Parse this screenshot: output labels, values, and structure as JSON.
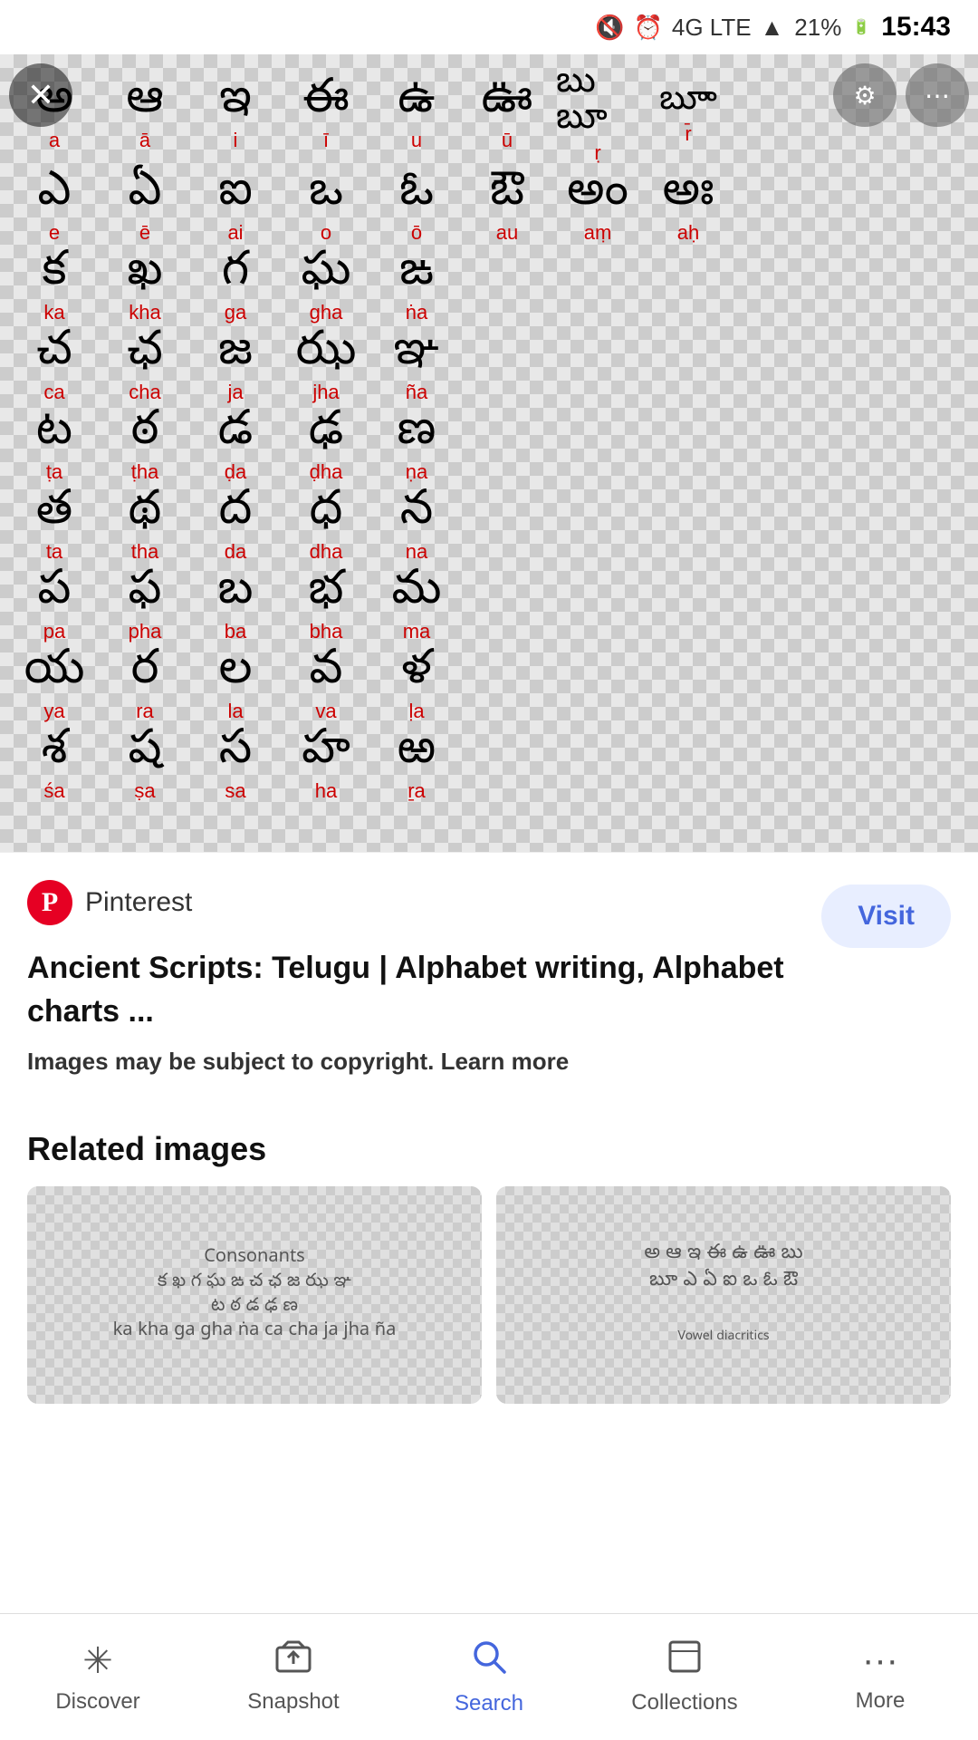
{
  "statusBar": {
    "time": "15:43",
    "battery": "21%",
    "network": "4G LTE",
    "signal": "●●●"
  },
  "image": {
    "altText": "Telugu alphabet chart",
    "rows": [
      [
        {
          "char": "అ",
          "label": "a"
        },
        {
          "char": "ఆ",
          "label": "ā"
        },
        {
          "char": "ఇ",
          "label": "i"
        },
        {
          "char": "ఈ",
          "label": "ī"
        },
        {
          "char": "ఉ",
          "label": "u"
        },
        {
          "char": "ఊ",
          "label": "ū"
        },
        {
          "char": "బు",
          "label": "ṛ"
        },
        {
          "char": "బూ",
          "label": "r̄"
        }
      ],
      [
        {
          "char": "ఎ",
          "label": "e"
        },
        {
          "char": "ఏ",
          "label": "ē"
        },
        {
          "char": "ఐ",
          "label": "ai"
        },
        {
          "char": "ఒ",
          "label": "o"
        },
        {
          "char": "ఓ",
          "label": "ō"
        },
        {
          "char": "ఔ",
          "label": "au"
        },
        {
          "char": "అం",
          "label": "aṃ"
        },
        {
          "char": "అః",
          "label": "aḥ"
        }
      ],
      [
        {
          "char": "క",
          "label": "ka"
        },
        {
          "char": "ఖ",
          "label": "kha"
        },
        {
          "char": "గ",
          "label": "ga"
        },
        {
          "char": "ఘ",
          "label": "gha"
        },
        {
          "char": "ఙ",
          "label": "ṅa"
        },
        {
          "char": "",
          "label": ""
        },
        {
          "char": "",
          "label": ""
        },
        {
          "char": "",
          "label": ""
        }
      ],
      [
        {
          "char": "చ",
          "label": "ca"
        },
        {
          "char": "ఛ",
          "label": "cha"
        },
        {
          "char": "జ",
          "label": "ja"
        },
        {
          "char": "ఝ",
          "label": "jha"
        },
        {
          "char": "ఞ",
          "label": "ña"
        },
        {
          "char": "",
          "label": ""
        },
        {
          "char": "",
          "label": ""
        },
        {
          "char": "",
          "label": ""
        }
      ],
      [
        {
          "char": "ట",
          "label": "ṭa"
        },
        {
          "char": "ఠ",
          "label": "ṭha"
        },
        {
          "char": "డ",
          "label": "ḍa"
        },
        {
          "char": "ఢ",
          "label": "ḍha"
        },
        {
          "char": "ణ",
          "label": "ṇa"
        },
        {
          "char": "",
          "label": ""
        },
        {
          "char": "",
          "label": ""
        },
        {
          "char": "",
          "label": ""
        }
      ],
      [
        {
          "char": "త",
          "label": "ta"
        },
        {
          "char": "థ",
          "label": "tha"
        },
        {
          "char": "ద",
          "label": "da"
        },
        {
          "char": "ధ",
          "label": "dha"
        },
        {
          "char": "న",
          "label": "na"
        },
        {
          "char": "",
          "label": ""
        },
        {
          "char": "",
          "label": ""
        },
        {
          "char": "",
          "label": ""
        }
      ],
      [
        {
          "char": "ప",
          "label": "pa"
        },
        {
          "char": "ఫ",
          "label": "pha"
        },
        {
          "char": "బ",
          "label": "ba"
        },
        {
          "char": "భ",
          "label": "bha"
        },
        {
          "char": "మ",
          "label": "ma"
        },
        {
          "char": "",
          "label": ""
        },
        {
          "char": "",
          "label": ""
        },
        {
          "char": "",
          "label": ""
        }
      ],
      [
        {
          "char": "య",
          "label": "ya"
        },
        {
          "char": "ర",
          "label": "ra"
        },
        {
          "char": "ల",
          "label": "la"
        },
        {
          "char": "వ",
          "label": "va"
        },
        {
          "char": "ళ",
          "label": "ḷa"
        },
        {
          "char": "",
          "label": ""
        },
        {
          "char": "",
          "label": ""
        },
        {
          "char": "",
          "label": ""
        }
      ],
      [
        {
          "char": "శ",
          "label": "śa"
        },
        {
          "char": "ష",
          "label": "ṣa"
        },
        {
          "char": "స",
          "label": "sa"
        },
        {
          "char": "హ",
          "label": "ha"
        },
        {
          "char": "ఱ",
          "label": "ṟa"
        },
        {
          "char": "",
          "label": ""
        },
        {
          "char": "",
          "label": ""
        },
        {
          "char": "",
          "label": ""
        }
      ]
    ]
  },
  "infoSection": {
    "sourceName": "Pinterest",
    "sourceLogo": "P",
    "visitLabel": "Visit",
    "title": "Ancient Scripts: Telugu | Alphabet writing, Alphabet charts ...",
    "copyrightText": "Images may be subject to copyright.",
    "learnMore": "Learn more"
  },
  "relatedSection": {
    "title": "Related images"
  },
  "bottomNav": {
    "items": [
      {
        "icon": "✳",
        "label": "Discover",
        "active": false
      },
      {
        "icon": "⬚↑",
        "label": "Snapshot",
        "active": false
      },
      {
        "icon": "🔍",
        "label": "Search",
        "active": true
      },
      {
        "icon": "⬚",
        "label": "Collections",
        "active": false
      },
      {
        "icon": "···",
        "label": "More",
        "active": false
      }
    ]
  }
}
